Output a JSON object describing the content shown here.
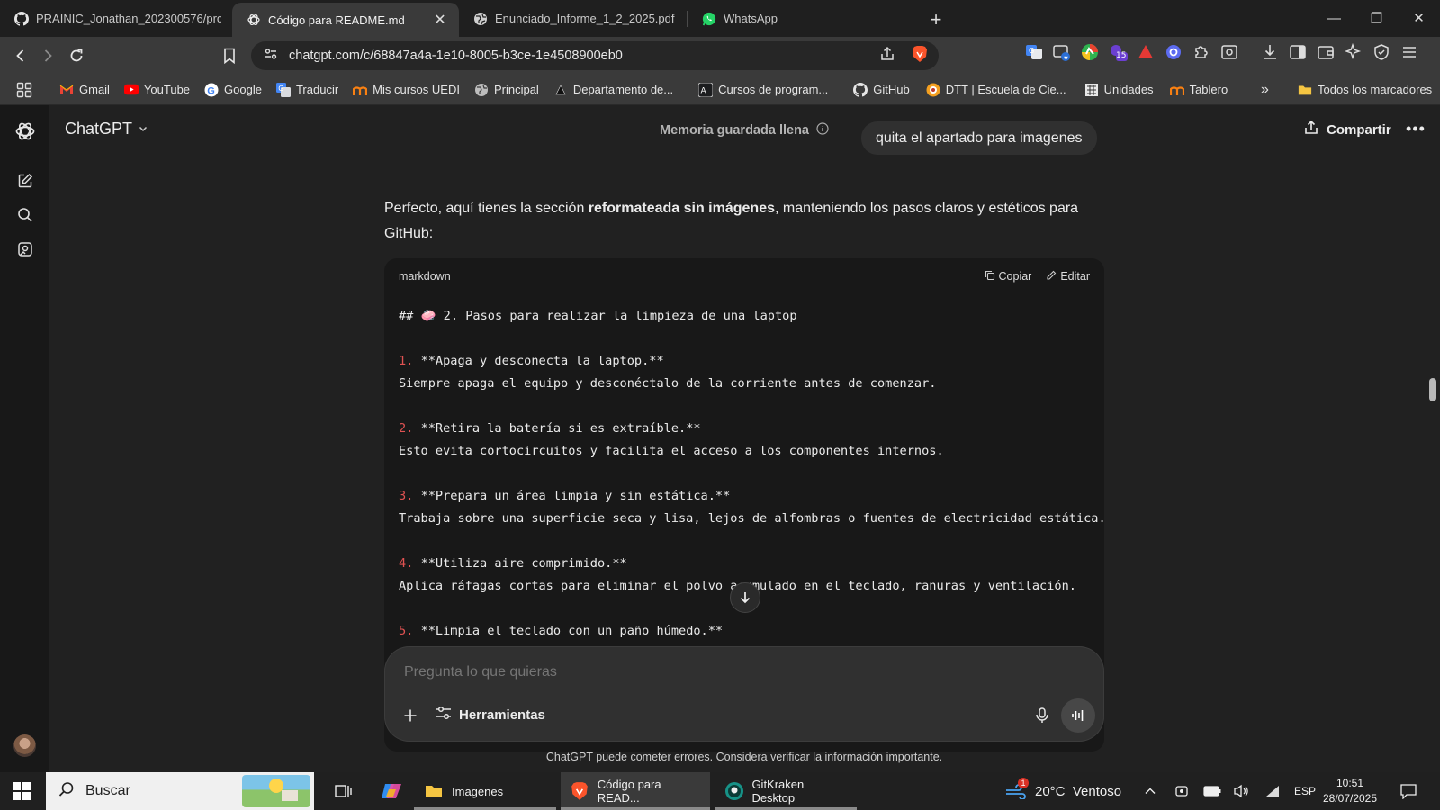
{
  "browser": {
    "tabs": [
      {
        "title": "PRAINIC_Jonathan_202300576/prom",
        "icon": "github-icon",
        "active": false
      },
      {
        "title": "Código para README.md",
        "icon": "chatgpt-icon",
        "active": true
      },
      {
        "title": "Enunciado_Informe_1_2_2025.pdf",
        "icon": "globe-icon",
        "active": false
      },
      {
        "title": "WhatsApp",
        "icon": "whatsapp-icon",
        "active": false
      }
    ],
    "new_tab": "+",
    "url": "chatgpt.com/c/68847a4a-1e10-8005-b3ce-1e4508900eb0",
    "extension_badge": "15",
    "bookmarks": [
      {
        "label": "Gmail",
        "icon": "gmail-icon"
      },
      {
        "label": "YouTube",
        "icon": "youtube-icon"
      },
      {
        "label": "Google",
        "icon": "google-icon"
      },
      {
        "label": "Traducir",
        "icon": "translate-icon"
      },
      {
        "label": "Mis cursos UEDI",
        "icon": "moodle-icon"
      },
      {
        "label": "Principal",
        "icon": "globe-icon"
      },
      {
        "label": "Departamento de...",
        "icon": "triangle-icon"
      },
      {
        "label": "Cursos de program...",
        "icon": "code-icon"
      },
      {
        "label": "GitHub",
        "icon": "github-icon"
      },
      {
        "label": "DTT | Escuela de Cie...",
        "icon": "school-icon"
      },
      {
        "label": "Unidades",
        "icon": "building-icon"
      },
      {
        "label": "Tablero",
        "icon": "moodle-icon"
      }
    ],
    "bookmarks_overflow": "»",
    "all_bookmarks": "Todos los marcadores"
  },
  "app": {
    "model_label": "ChatGPT",
    "memory_label": "Memoria guardada llena",
    "share_label": "Compartir",
    "user_message": "quita el apartado para imagenes",
    "assistant": {
      "intro_1": "Perfecto, aquí tienes la sección ",
      "intro_bold": "reformateada sin imágenes",
      "intro_2": ", manteniendo los pasos claros y estéticos para GitHub:"
    },
    "code": {
      "language": "markdown",
      "copy_label": "Copiar",
      "edit_label": "Editar",
      "heading": "## 🧼 2. Pasos para realizar la limpieza de una laptop",
      "steps": [
        {
          "num": "1.",
          "title": "**Apaga y desconecta la laptop.**",
          "text": "Siempre apaga el equipo y desconéctalo de la corriente antes de comenzar."
        },
        {
          "num": "2.",
          "title": "**Retira la batería si es extraíble.**",
          "text": "Esto evita cortocircuitos y facilita el acceso a los componentes internos."
        },
        {
          "num": "3.",
          "title": "**Prepara un área limpia y sin estática.**",
          "text": "Trabaja sobre una superficie seca y lisa, lejos de alfombras o fuentes de electricidad estática."
        },
        {
          "num": "4.",
          "title": "**Utiliza aire comprimido.**",
          "text": "Aplica ráfagas cortas para eliminar el polvo acumulado en el teclado, ranuras y ventilación."
        },
        {
          "num": "5.",
          "title": "**Limpia el teclado con un paño húmedo.**",
          "text": ""
        }
      ]
    },
    "composer": {
      "placeholder": "Pregunta lo que quieras",
      "tools_label": "Herramientas"
    },
    "disclaimer": "ChatGPT puede cometer errores. Considera verificar la información importante."
  },
  "taskbar": {
    "search_label": "Buscar",
    "apps": [
      {
        "label": "Imagenes",
        "icon": "folder-icon"
      },
      {
        "label": "Código para READ...",
        "icon": "brave-icon"
      },
      {
        "label": "GitKraken Desktop",
        "icon": "gitkraken-icon"
      }
    ],
    "weather": "20°C  Ventoso",
    "weather_badge": "1",
    "language": "ESP",
    "time": "10:51",
    "date": "28/07/2025"
  },
  "colors": {
    "background": "#212121",
    "code_background": "#181818",
    "list_number": "#e05252",
    "brave_orange": "#fb542b"
  }
}
